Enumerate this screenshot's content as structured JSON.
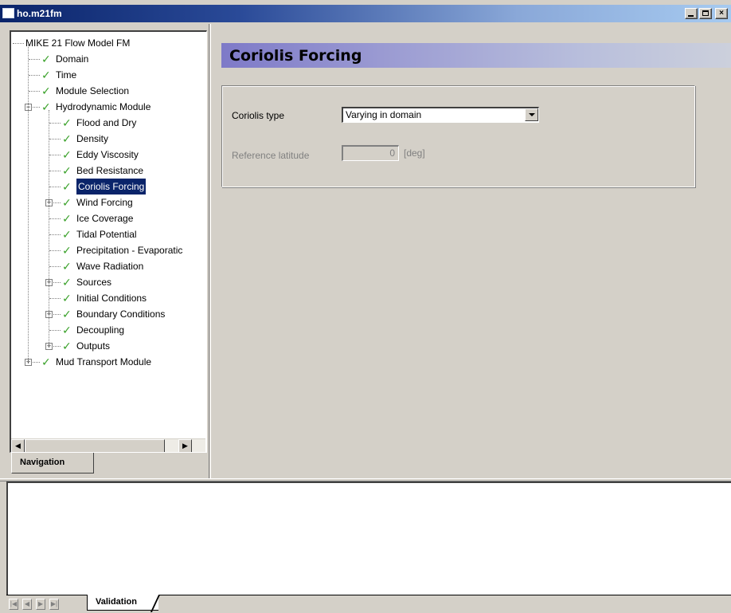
{
  "window": {
    "title": "ho.m21fm",
    "controls": {
      "minimize": "_",
      "maximize": "□",
      "close": "×"
    }
  },
  "navigation": {
    "tab_label": "Navigation",
    "tree": [
      {
        "label": "MIKE 21 Flow Model FM",
        "level": 0,
        "checked": false,
        "expander": ""
      },
      {
        "label": "Domain",
        "level": 1,
        "checked": true,
        "expander": ""
      },
      {
        "label": "Time",
        "level": 1,
        "checked": true,
        "expander": ""
      },
      {
        "label": "Module Selection",
        "level": 1,
        "checked": true,
        "expander": ""
      },
      {
        "label": "Hydrodynamic Module",
        "level": 1,
        "checked": true,
        "expander": "−"
      },
      {
        "label": "Flood and Dry",
        "level": 2,
        "checked": true,
        "expander": ""
      },
      {
        "label": "Density",
        "level": 2,
        "checked": true,
        "expander": ""
      },
      {
        "label": "Eddy Viscosity",
        "level": 2,
        "checked": true,
        "expander": ""
      },
      {
        "label": "Bed Resistance",
        "level": 2,
        "checked": true,
        "expander": ""
      },
      {
        "label": "Coriolis Forcing",
        "level": 2,
        "checked": true,
        "expander": "",
        "selected": true
      },
      {
        "label": "Wind Forcing",
        "level": 2,
        "checked": true,
        "expander": "+"
      },
      {
        "label": "Ice Coverage",
        "level": 2,
        "checked": true,
        "expander": ""
      },
      {
        "label": "Tidal Potential",
        "level": 2,
        "checked": true,
        "expander": ""
      },
      {
        "label": "Precipitation - Evaporatic",
        "level": 2,
        "checked": true,
        "expander": ""
      },
      {
        "label": "Wave Radiation",
        "level": 2,
        "checked": true,
        "expander": ""
      },
      {
        "label": "Sources",
        "level": 2,
        "checked": true,
        "expander": "+"
      },
      {
        "label": "Initial Conditions",
        "level": 2,
        "checked": true,
        "expander": ""
      },
      {
        "label": "Boundary Conditions",
        "level": 2,
        "checked": true,
        "expander": "+"
      },
      {
        "label": "Decoupling",
        "level": 2,
        "checked": true,
        "expander": ""
      },
      {
        "label": "Outputs",
        "level": 2,
        "checked": true,
        "expander": "+"
      },
      {
        "label": "Mud Transport Module",
        "level": 1,
        "checked": true,
        "expander": "+"
      }
    ]
  },
  "main": {
    "header": "Coriolis Forcing",
    "coriolis_type_label": "Coriolis type",
    "coriolis_type_value": "Varying in domain",
    "reference_latitude_label": "Reference latitude",
    "reference_latitude_value": "0",
    "reference_latitude_unit": "[deg]"
  },
  "bottom": {
    "tab_label": "Validation"
  },
  "icons": {
    "check": "check-icon",
    "expand": "plus-box-icon",
    "collapse": "minus-box-icon"
  }
}
